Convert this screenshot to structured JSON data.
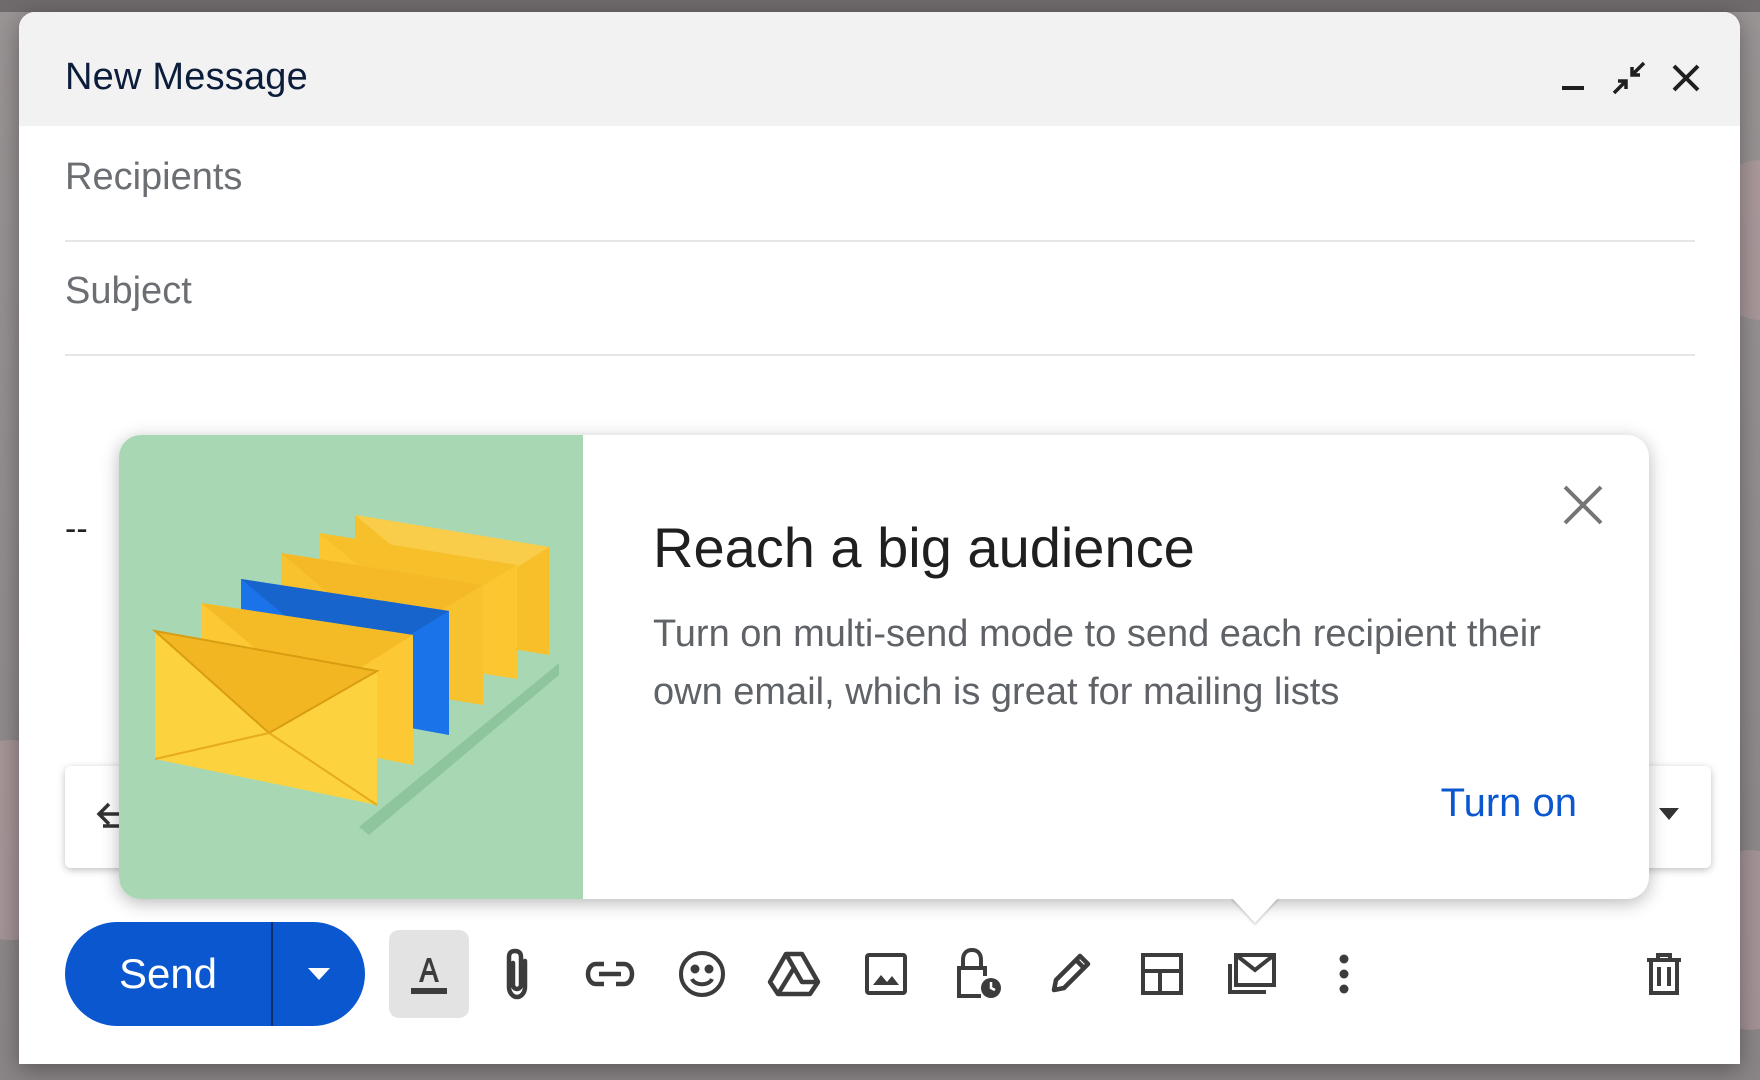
{
  "compose": {
    "title": "New Message",
    "recipients_placeholder": "Recipients",
    "subject_placeholder": "Subject",
    "signature": "--"
  },
  "header_icons": [
    "minimize-icon",
    "exit-fullscreen-icon",
    "close-icon"
  ],
  "promo": {
    "title": "Reach a big audience",
    "body": "Turn on multi-send mode to send each recipient their own email, which is great for mailing lists",
    "action_label": "Turn on",
    "art_background": "#a8d8b3",
    "envelope_yellow": "#fcc934",
    "envelope_blue": "#1a73e8"
  },
  "send": {
    "label": "Send",
    "color": "#0b57d0"
  },
  "toolbar_icons": [
    "formatting-options-icon",
    "attach-files-icon",
    "insert-link-icon",
    "insert-emoji-icon",
    "insert-drive-file-icon",
    "insert-photo-icon",
    "confidential-mode-icon",
    "insert-signature-icon",
    "layouts-icon",
    "multi-send-icon",
    "more-options-icon",
    "discard-draft-icon"
  ]
}
